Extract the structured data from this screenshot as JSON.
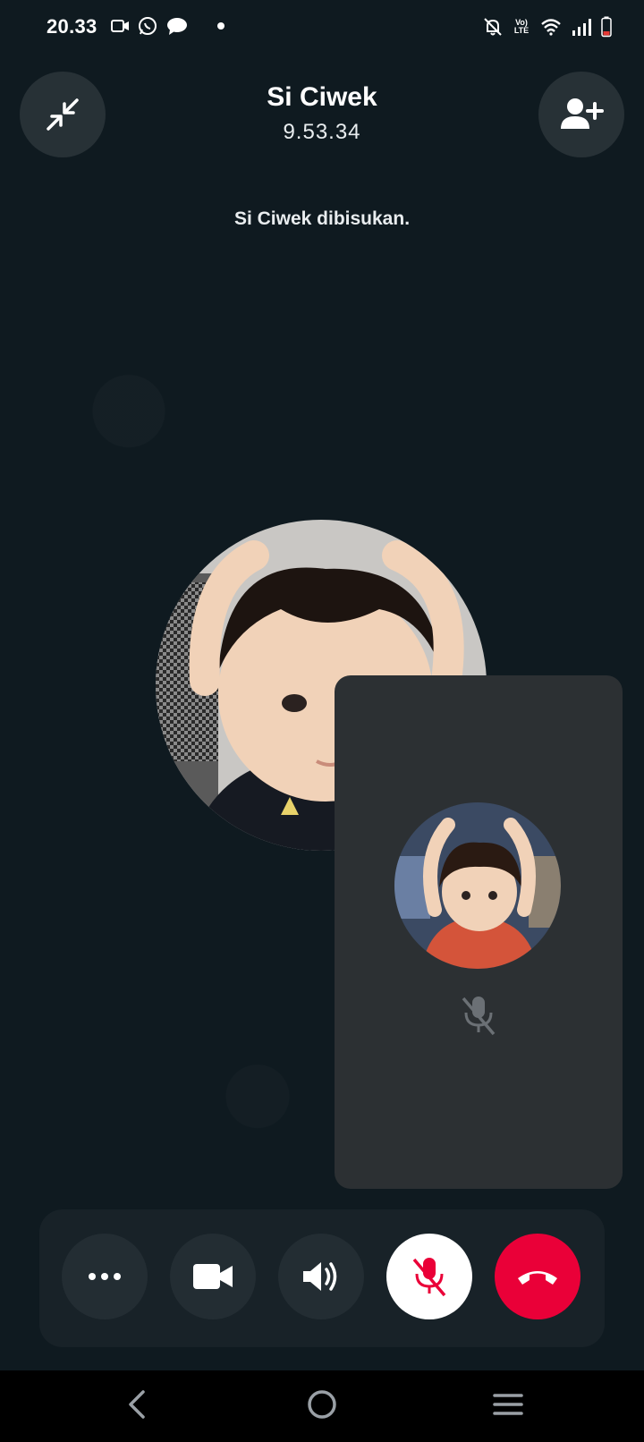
{
  "status_bar": {
    "time": "20.33",
    "icons": [
      "video-record-icon",
      "whatsapp-icon",
      "message-icon",
      "dot-icon",
      "mute-notification-icon",
      "volte-icon",
      "wifi-icon",
      "signal-icon",
      "battery-icon"
    ],
    "volte_label": "Vo) LTE"
  },
  "header": {
    "contact_name": "Si Ciwek",
    "call_timer": "9.53.34",
    "muted_notice": "Si Ciwek dibisukan."
  },
  "controls": {
    "buttons": [
      "more-options",
      "video-camera",
      "speaker",
      "mute-mic",
      "end-call"
    ]
  },
  "colors": {
    "background": "#0f1a20",
    "end_call": "#ea0038",
    "mute_active_bg": "#ffffff",
    "mute_active_icon": "#ea0038"
  },
  "nav": {
    "icons": [
      "back-icon",
      "home-icon",
      "recents-icon"
    ]
  }
}
